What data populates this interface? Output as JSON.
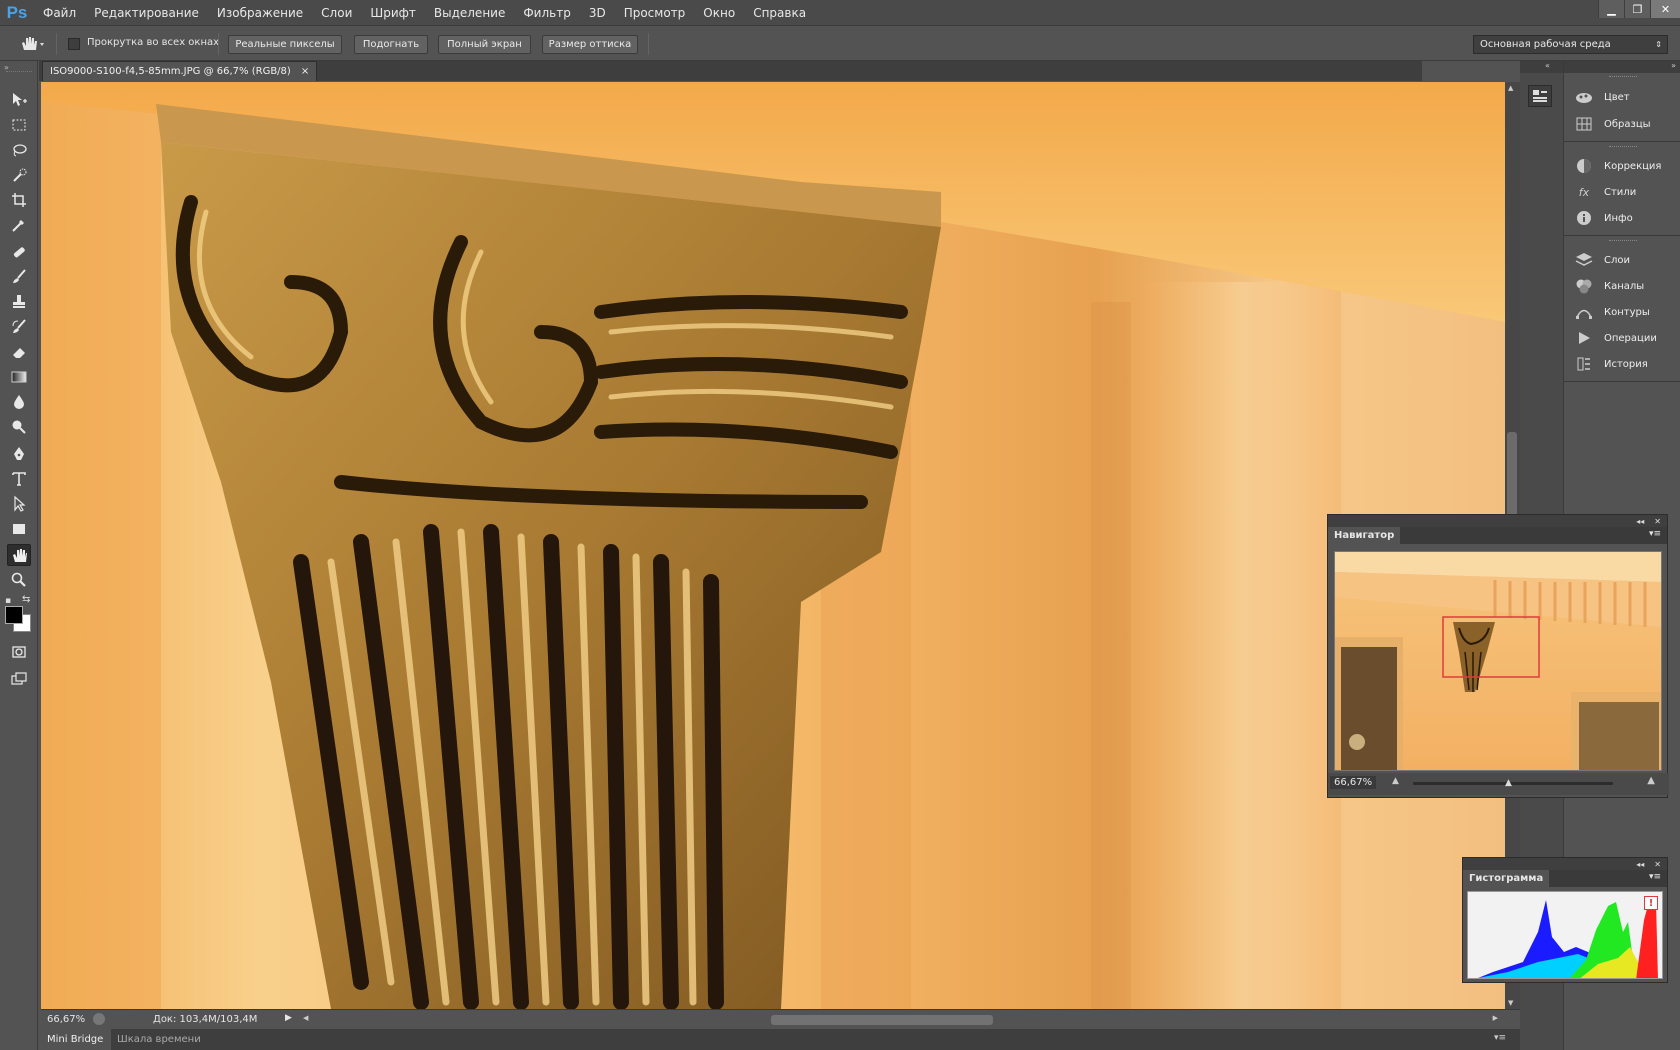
{
  "app": {
    "logo": "Ps"
  },
  "menu": [
    "Файл",
    "Редактирование",
    "Изображение",
    "Слои",
    "Шрифт",
    "Выделение",
    "Фильтр",
    "3D",
    "Просмотр",
    "Окно",
    "Справка"
  ],
  "options": {
    "scroll_all_label": "Прокрутка во всех окнах",
    "btn_actual": "Реальные пикселы",
    "btn_fit": "Подогнать",
    "btn_fill": "Полный экран",
    "btn_print": "Размер оттиска",
    "workspace": "Основная рабочая среда"
  },
  "document": {
    "tab_title": "ISO9000-S100-f4,5-85mm.JPG @ 66,7% (RGB/8)",
    "close": "×"
  },
  "status": {
    "zoom": "66,67%",
    "doc_size": "Док: 103,4M/103,4M"
  },
  "bottom_tabs": [
    "Mini Bridge",
    "Шкала времени"
  ],
  "right_panels": {
    "group1": [
      "Цвет",
      "Образцы"
    ],
    "group2": [
      "Коррекция",
      "Стили",
      "Инфо"
    ],
    "group3": [
      "Слои",
      "Каналы",
      "Контуры",
      "Операции",
      "История"
    ]
  },
  "navigator": {
    "title": "Навигатор",
    "zoom": "66,67%",
    "slider_level": 0.48
  },
  "histogram": {
    "title": "Гистограмма",
    "warning": "!"
  },
  "colors": {
    "accent": "#4aa3e8",
    "panel": "#535353",
    "dark": "#3e3e3e",
    "nav_frame": "#e23a3a"
  },
  "icons": [
    "hand-icon",
    "move-icon",
    "marquee-icon",
    "lasso-icon",
    "quick-select-icon",
    "crop-icon",
    "eyedropper-icon",
    "healing-icon",
    "brush-icon",
    "stamp-icon",
    "history-brush-icon",
    "eraser-icon",
    "gradient-icon",
    "blur-icon",
    "dodge-icon",
    "pen-icon",
    "type-icon",
    "path-select-icon",
    "rectangle-icon",
    "zoom-icon",
    "quick-mask-icon",
    "screen-mode-icon"
  ]
}
